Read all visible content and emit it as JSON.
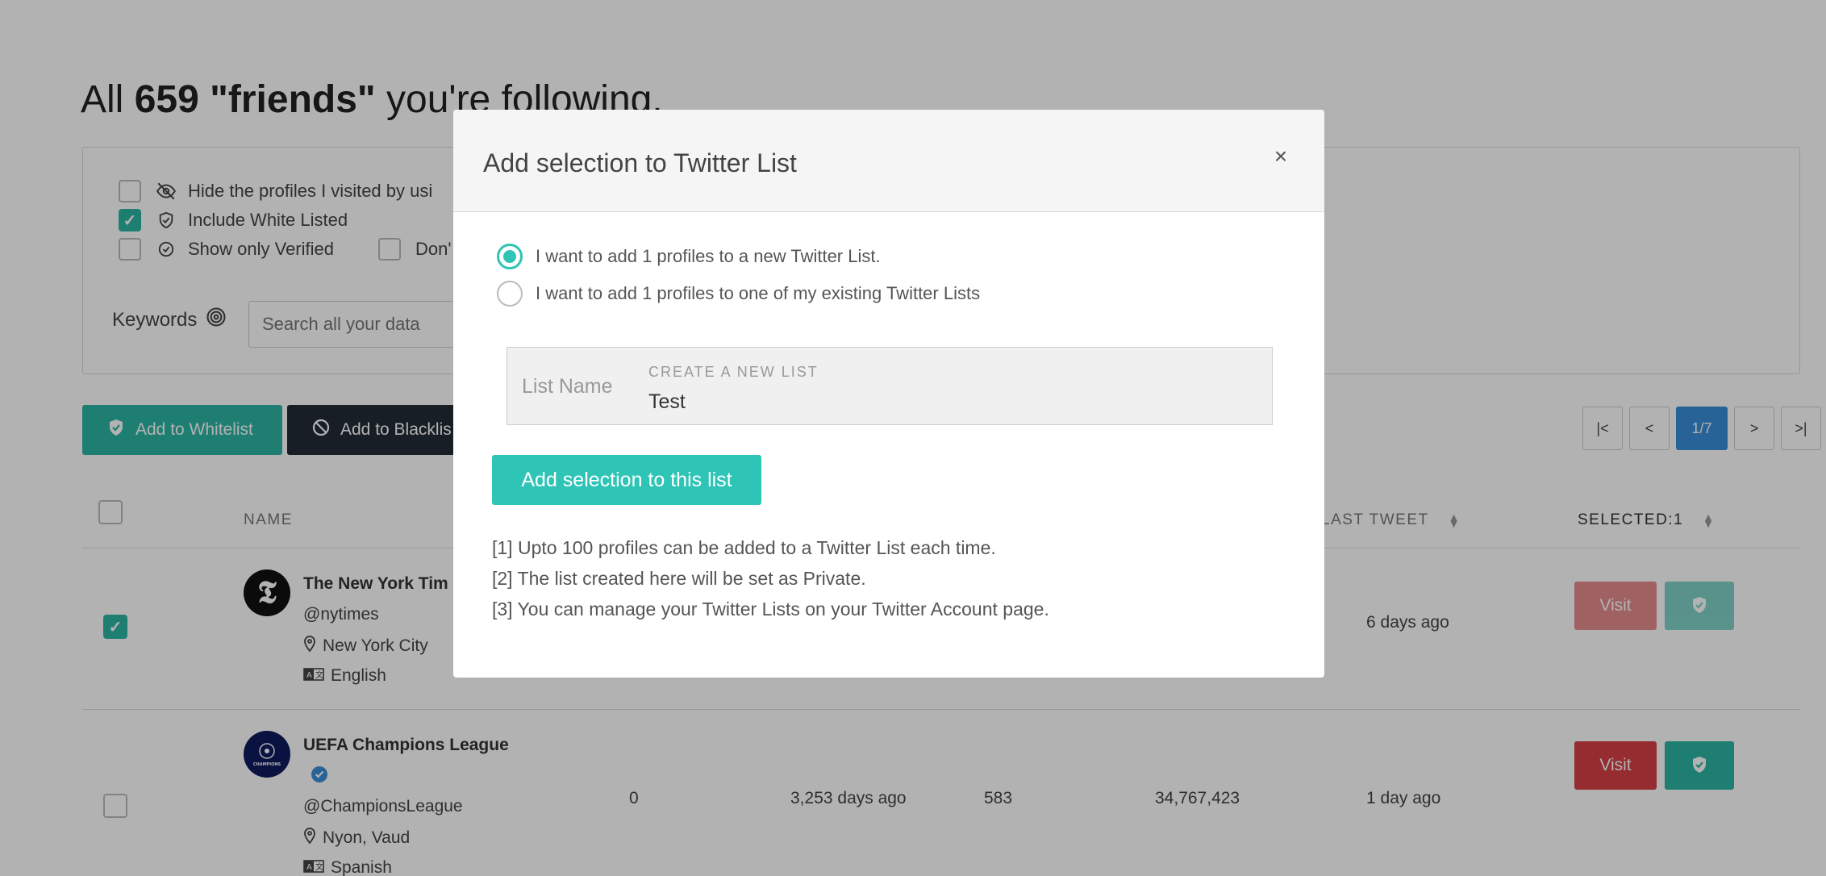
{
  "page": {
    "title_prefix": "All",
    "title_count": "659",
    "title_quoted": "\"friends\"",
    "title_suffix": "you're following."
  },
  "filters": {
    "hide_visited": {
      "label": "Hide the profiles I visited by usi",
      "checked": false
    },
    "include_whitelisted": {
      "label": "Include White Listed",
      "checked": true
    },
    "show_verified": {
      "label": "Show only Verified",
      "checked": false
    },
    "dont": {
      "label": "Don'",
      "checked": false
    },
    "keywords_label": "Keywords",
    "search_placeholder": "Search all your data"
  },
  "actions": {
    "whitelist_label": "Add to Whitelist",
    "blacklist_label": "Add to Blacklis"
  },
  "pagination": {
    "first": "|<",
    "prev": "<",
    "current": "1/7",
    "next": ">",
    "last": ">|"
  },
  "table": {
    "headers": {
      "name": "NAME",
      "last_tweet": "LAST TWEET",
      "selected": "SELECTED:1"
    },
    "rows": [
      {
        "name": "The New York Tim",
        "handle": "@nytimes",
        "location": "New York City",
        "language": "English",
        "col1": "",
        "col2": "",
        "col3": "",
        "col4": "",
        "last_tweet": "6 days ago",
        "visit_label": "Visit",
        "checked": true
      },
      {
        "name": "UEFA Champions League",
        "handle": "@ChampionsLeague",
        "location": "Nyon, Vaud",
        "language": "Spanish",
        "col1": "0",
        "col2": "3,253 days ago",
        "col3": "583",
        "col4": "34,767,423",
        "last_tweet": "1 day ago",
        "visit_label": "Visit",
        "checked": false
      }
    ]
  },
  "modal": {
    "title": "Add selection to Twitter List",
    "close": "×",
    "option_new": "I want to add 1 profiles to a new Twitter List.",
    "option_existing": "I want to add 1 profiles to one of my existing Twitter Lists",
    "selected_option": "new",
    "list_name_label": "List Name",
    "list_caption": "CREATE A NEW LIST",
    "list_value": "Test",
    "submit_label": "Add selection to this list",
    "notes": [
      "[1] Upto 100 profiles can be added to a Twitter List each time.",
      "[2] The list created here will be set as Private.",
      "[3] You can manage your Twitter Lists on your Twitter Account page."
    ]
  },
  "colors": {
    "teal": "#2bb5a4",
    "modal_teal": "#2ec4b6",
    "visit_red": "#d64045",
    "pager_blue": "#3a8fd8",
    "dark_button": "#222b36"
  }
}
